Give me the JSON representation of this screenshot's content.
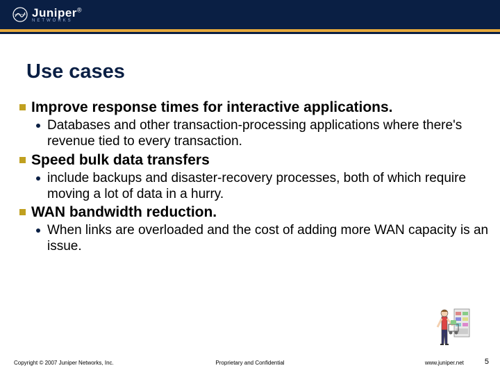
{
  "header": {
    "logo_text": "Juniper",
    "logo_sub": "NETWORKS"
  },
  "title": "Use cases",
  "bullets": [
    {
      "text": "Improve response times for interactive applications.",
      "subs": [
        "Databases and other transaction-processing applications where there's revenue tied to every transaction."
      ]
    },
    {
      "text": "Speed bulk data transfers",
      "subs": [
        "include backups and disaster-recovery processes, both of which require moving a lot of data in a hurry."
      ]
    },
    {
      "text": "WAN bandwidth reduction.",
      "subs": [
        "When links are overloaded and the cost of adding more WAN capacity is an issue."
      ]
    }
  ],
  "footer": {
    "copyright": "Copyright © 2007 Juniper Networks, Inc.",
    "center": "Proprietary and Confidential",
    "url": "www.juniper.net",
    "page": "5"
  }
}
